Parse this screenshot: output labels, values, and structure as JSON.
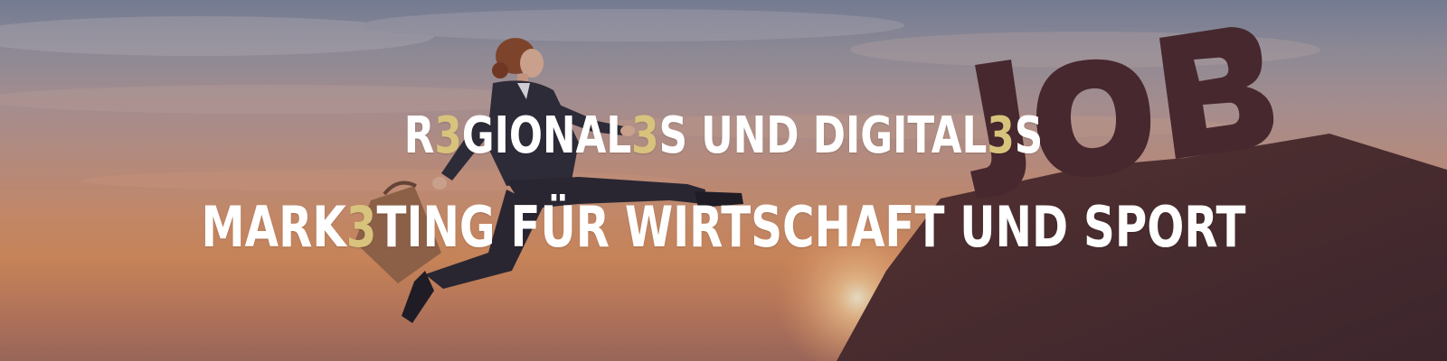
{
  "banner": {
    "line1": {
      "parts": [
        "R",
        "3",
        "GIONAL",
        "3",
        "S UND DIGITAL",
        "3",
        "S"
      ]
    },
    "line2": {
      "parts": [
        "MARK",
        "3",
        "TING FÜR WIRTSCHAFT UND SPORT"
      ]
    },
    "sign_text": "JOB"
  },
  "colors": {
    "text": "#ffffff",
    "accent": "#d8c37d",
    "cliff": "#4d2f33"
  }
}
